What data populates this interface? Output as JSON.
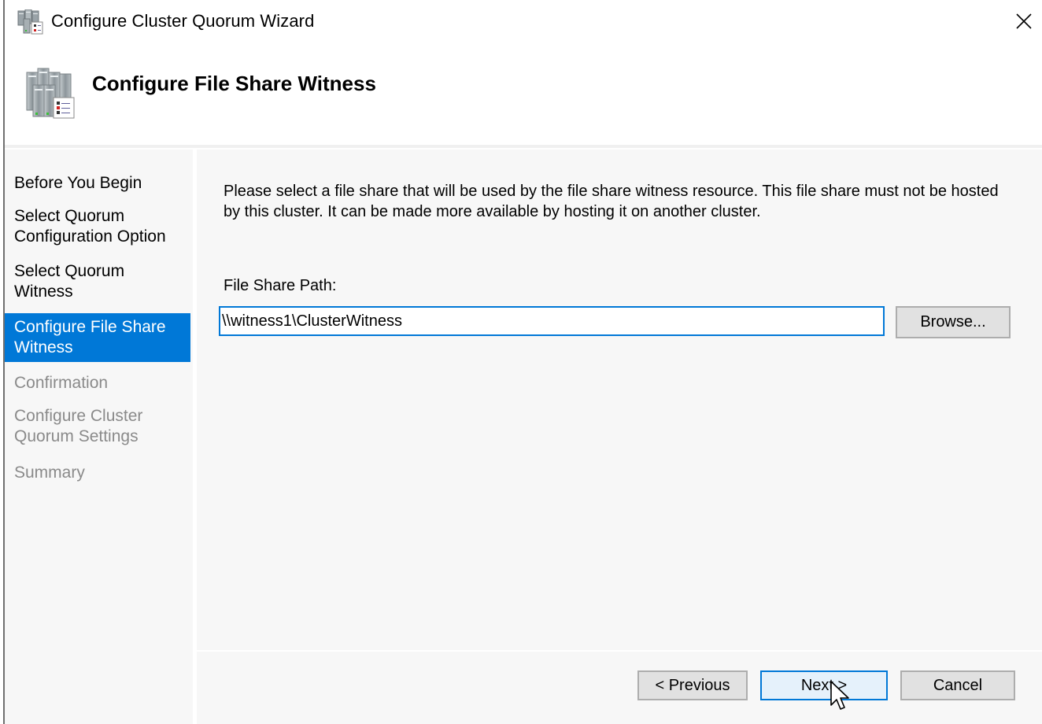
{
  "window": {
    "title": "Configure Cluster Quorum Wizard",
    "app_icon": "cluster-servers-icon",
    "close_icon": "close-icon"
  },
  "header": {
    "title": "Configure File Share Witness",
    "icon": "cluster-servers-checklist-icon"
  },
  "nav": {
    "items": [
      {
        "label": "Before You Begin",
        "state": "completed"
      },
      {
        "label": "Select Quorum Configuration Option",
        "state": "completed"
      },
      {
        "label": "Select Quorum Witness",
        "state": "completed"
      },
      {
        "label": "Configure File Share Witness",
        "state": "active"
      },
      {
        "label": "Confirmation",
        "state": "disabled"
      },
      {
        "label": "Configure Cluster Quorum Settings",
        "state": "disabled"
      },
      {
        "label": "Summary",
        "state": "disabled"
      }
    ]
  },
  "main": {
    "description": "Please select a file share that will be used by the file share witness resource.  This file share must not be hosted by this cluster.  It can be made more available by hosting it on another cluster.",
    "file_share_path_label": "File Share Path:",
    "file_share_path_value": "\\\\witness1\\ClusterWitness",
    "browse_label": "Browse..."
  },
  "footer": {
    "previous_label": "< Previous",
    "next_label": "Next >",
    "cancel_label": "Cancel"
  },
  "colors": {
    "accent": "#0078d7",
    "nav_background": "#f7f7f7",
    "disabled_text": "#8a8a8a",
    "button_face": "#e1e1e1",
    "default_button_face": "#e5f1fb"
  }
}
